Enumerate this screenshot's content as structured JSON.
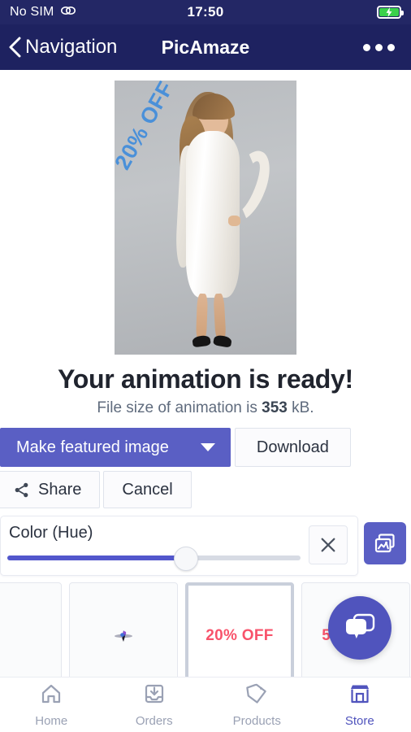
{
  "status_bar": {
    "carrier": "No SIM",
    "carrier_icon": "link-icon",
    "time": "17:50",
    "battery_icon": "battery-charging-icon",
    "battery_level_percent": 85
  },
  "nav_bar": {
    "back_icon": "chevron-left-icon",
    "back_label": "Navigation",
    "title": "PicAmaze",
    "more_icon": "ellipsis-icon"
  },
  "preview": {
    "overlay_text": "20% OFF",
    "overlay_color": "#4a90d9",
    "alt": "woman in white dress on grey background"
  },
  "result": {
    "headline": "Your animation is ready!",
    "filesize_prefix": "File size of animation is ",
    "filesize_value": "353",
    "filesize_suffix": " kB."
  },
  "actions": {
    "featured_label": "Make featured image",
    "featured_caret_icon": "chevron-down-icon",
    "download_label": "Download",
    "share_label": "Share",
    "share_icon": "share-nodes-icon",
    "cancel_label": "Cancel",
    "accent_color": "#5a5fc4"
  },
  "hue_panel": {
    "label": "Color (Hue)",
    "slider_value_percent": 61,
    "close_icon": "close-x-icon",
    "gallery_icon": "images-stack-icon"
  },
  "thumbnails": {
    "items": [
      {
        "name": "thumb-blank",
        "label": "",
        "icon": "",
        "selected": false
      },
      {
        "name": "thumb-hummingbird",
        "label": "",
        "icon": "hummingbird-icon",
        "selected": false
      },
      {
        "name": "thumb-20-off",
        "label": "20% OFF",
        "icon": "",
        "selected": true
      },
      {
        "name": "thumb-50-off",
        "label": "50% OFF",
        "icon": "",
        "selected": false
      }
    ],
    "scroll_position_percent": 3
  },
  "chat": {
    "icon": "chat-bubbles-icon",
    "color": "#5054bd"
  },
  "tab_bar": {
    "items": [
      {
        "label": "Home",
        "icon": "home-icon",
        "active": false
      },
      {
        "label": "Orders",
        "icon": "inbox-download-icon",
        "active": false
      },
      {
        "label": "Products",
        "icon": "tag-icon",
        "active": false
      },
      {
        "label": "Store",
        "icon": "storefront-icon",
        "active": true
      }
    ],
    "active_color": "#5054bd",
    "inactive_color": "#9aa1b4"
  }
}
